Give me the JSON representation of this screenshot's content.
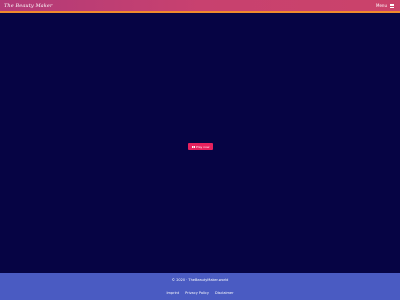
{
  "header": {
    "brand": "The Beauty Maker",
    "menu_label": "Menu",
    "menu_icon": "hamburger-icon"
  },
  "main": {
    "play_button_label": "Play now",
    "play_button_icon": "youtube-icon"
  },
  "footer": {
    "copyright": "© 2020 · TheBeautyMaker.world",
    "links": [
      "Imprint",
      "Privacy Policy",
      "Disclaimer"
    ]
  },
  "colors": {
    "header_start": "#b23a78",
    "header_end": "#ca426a",
    "header_border": "#f08a2d",
    "main_background": "#060444",
    "play_button": "#e6215e",
    "footer_background": "#4a5bc2"
  }
}
